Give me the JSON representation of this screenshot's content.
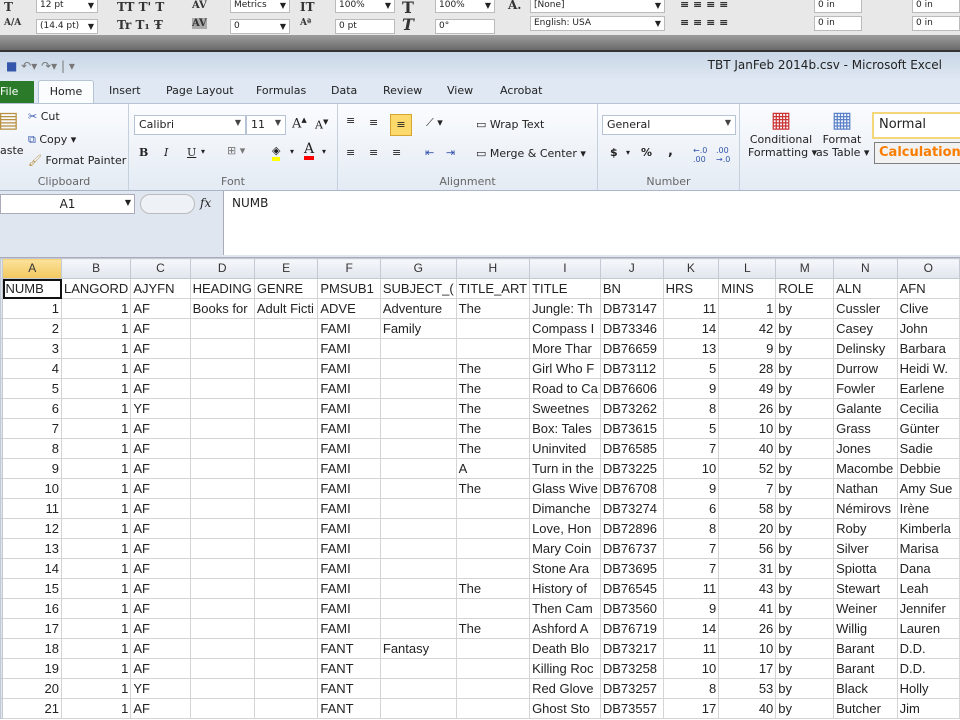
{
  "indesign_toolbar": {
    "font_size": "12 pt",
    "leading": "(14.4 pt)",
    "kerning": "Metrics",
    "tracking": "0",
    "vertical_scale": "100%",
    "horizontal_scale": "100%",
    "baseline_shift": "0 pt",
    "skew": "0°",
    "char_style": "[None]",
    "language": "English: USA",
    "indent_left": "0 in",
    "indent_right": "0 in",
    "indent_first": "0 in",
    "indent_last": "0 in"
  },
  "window": {
    "title": "TBT JanFeb 2014b.csv  -  Microsoft Excel"
  },
  "tabs": [
    "File",
    "Home",
    "Insert",
    "Page Layout",
    "Formulas",
    "Data",
    "Review",
    "View",
    "Acrobat"
  ],
  "active_tab": "Home",
  "ribbon": {
    "clipboard": {
      "paste": "aste",
      "cut": "Cut",
      "copy": "Copy",
      "format_painter": "Format Painter",
      "label": "Clipboard"
    },
    "font": {
      "name": "Calibri",
      "size": "11",
      "bold": "B",
      "italic": "I",
      "underline": "U",
      "label": "Font",
      "highlight_color": "#ffff00",
      "font_color": "#ff0000"
    },
    "alignment": {
      "wrap_text": "Wrap Text",
      "merge_center": "Merge & Center",
      "label": "Alignment"
    },
    "number": {
      "format": "General",
      "currency": "$",
      "percent": "%",
      "comma": ",",
      "label": "Number"
    },
    "styles": {
      "conditional_formatting": [
        "Conditional",
        "Formatting"
      ],
      "format_as_table": [
        "Format",
        "as Table"
      ],
      "normal": "Normal",
      "calculation": "Calculation",
      "calculation_color": "#fa7d00"
    }
  },
  "formula_bar": {
    "name_box": "A1",
    "fx": "fx",
    "value": "NUMB"
  },
  "sheet": {
    "columns": [
      "A",
      "B",
      "C",
      "D",
      "E",
      "F",
      "G",
      "H",
      "I",
      "J",
      "K",
      "L",
      "M",
      "N",
      "O"
    ],
    "selected_column": "A",
    "numeric_columns": [
      0,
      1,
      10,
      11
    ],
    "header": [
      "NUMB",
      "LANGORD",
      "AJYFN",
      "HEADING",
      "GENRE",
      "PMSUB1",
      "SUBJECT_(",
      "TITLE_ART",
      "TITLE",
      "BN",
      "HRS",
      "MINS",
      "ROLE",
      "ALN",
      "AFN"
    ],
    "rows": [
      [
        "1",
        "1",
        "AF",
        "Books for",
        "Adult Ficti",
        "ADVE",
        "Adventure",
        "The",
        "Jungle: Th",
        "DB73147",
        "11",
        "1",
        "by",
        "Cussler",
        "Clive"
      ],
      [
        "2",
        "1",
        "AF",
        "",
        "",
        "FAMI",
        "Family",
        "",
        "Compass I",
        "DB73346",
        "14",
        "42",
        "by",
        "Casey",
        "John"
      ],
      [
        "3",
        "1",
        "AF",
        "",
        "",
        "FAMI",
        "",
        "",
        "More Thar",
        "DB76659",
        "13",
        "9",
        "by",
        "Delinsky",
        "Barbara"
      ],
      [
        "4",
        "1",
        "AF",
        "",
        "",
        "FAMI",
        "",
        "The",
        "Girl Who F",
        "DB73112",
        "5",
        "28",
        "by",
        "Durrow",
        "Heidi W."
      ],
      [
        "5",
        "1",
        "AF",
        "",
        "",
        "FAMI",
        "",
        "The",
        "Road to Ca",
        "DB76606",
        "9",
        "49",
        "by",
        "Fowler",
        "Earlene"
      ],
      [
        "6",
        "1",
        "YF",
        "",
        "",
        "FAMI",
        "",
        "The",
        "Sweetnes",
        "DB73262",
        "8",
        "26",
        "by",
        "Galante",
        "Cecilia"
      ],
      [
        "7",
        "1",
        "AF",
        "",
        "",
        "FAMI",
        "",
        "The",
        "Box: Tales",
        "DB73615",
        "5",
        "10",
        "by",
        "Grass",
        "Günter"
      ],
      [
        "8",
        "1",
        "AF",
        "",
        "",
        "FAMI",
        "",
        "The",
        "Uninvited",
        "DB76585",
        "7",
        "40",
        "by",
        "Jones",
        "Sadie"
      ],
      [
        "9",
        "1",
        "AF",
        "",
        "",
        "FAMI",
        "",
        "A",
        "Turn in the",
        "DB73225",
        "10",
        "52",
        "by",
        "Macombe",
        "Debbie"
      ],
      [
        "10",
        "1",
        "AF",
        "",
        "",
        "FAMI",
        "",
        "The",
        "Glass Wive",
        "DB76708",
        "9",
        "7",
        "by",
        "Nathan",
        "Amy Sue"
      ],
      [
        "11",
        "1",
        "AF",
        "",
        "",
        "FAMI",
        "",
        "",
        "Dimanche",
        "DB73274",
        "6",
        "58",
        "by",
        "Némirovs",
        "Irène"
      ],
      [
        "12",
        "1",
        "AF",
        "",
        "",
        "FAMI",
        "",
        "",
        "Love, Hon",
        "DB72896",
        "8",
        "20",
        "by",
        "Roby",
        "Kimberla"
      ],
      [
        "13",
        "1",
        "AF",
        "",
        "",
        "FAMI",
        "",
        "",
        "Mary Coin",
        "DB76737",
        "7",
        "56",
        "by",
        "Silver",
        "Marisa"
      ],
      [
        "14",
        "1",
        "AF",
        "",
        "",
        "FAMI",
        "",
        "",
        "Stone Ara",
        "DB73695",
        "7",
        "31",
        "by",
        "Spiotta",
        "Dana"
      ],
      [
        "15",
        "1",
        "AF",
        "",
        "",
        "FAMI",
        "",
        "The",
        "History of",
        "DB76545",
        "11",
        "43",
        "by",
        "Stewart",
        "Leah"
      ],
      [
        "16",
        "1",
        "AF",
        "",
        "",
        "FAMI",
        "",
        "",
        "Then Cam",
        "DB73560",
        "9",
        "41",
        "by",
        "Weiner",
        "Jennifer"
      ],
      [
        "17",
        "1",
        "AF",
        "",
        "",
        "FAMI",
        "",
        "The",
        "Ashford A",
        "DB76719",
        "14",
        "26",
        "by",
        "Willig",
        "Lauren"
      ],
      [
        "18",
        "1",
        "AF",
        "",
        "",
        "FANT",
        "Fantasy",
        "",
        "Death Blo",
        "DB73217",
        "11",
        "10",
        "by",
        "Barant",
        "D.D."
      ],
      [
        "19",
        "1",
        "AF",
        "",
        "",
        "FANT",
        "",
        "",
        "Killing Roc",
        "DB73258",
        "10",
        "17",
        "by",
        "Barant",
        "D.D."
      ],
      [
        "20",
        "1",
        "YF",
        "",
        "",
        "FANT",
        "",
        "",
        "Red Glove",
        "DB73257",
        "8",
        "53",
        "by",
        "Black",
        "Holly"
      ],
      [
        "21",
        "1",
        "AF",
        "",
        "",
        "FANT",
        "",
        "",
        "Ghost Sto",
        "DB73557",
        "17",
        "40",
        "by",
        "Butcher",
        "Jim"
      ]
    ]
  }
}
